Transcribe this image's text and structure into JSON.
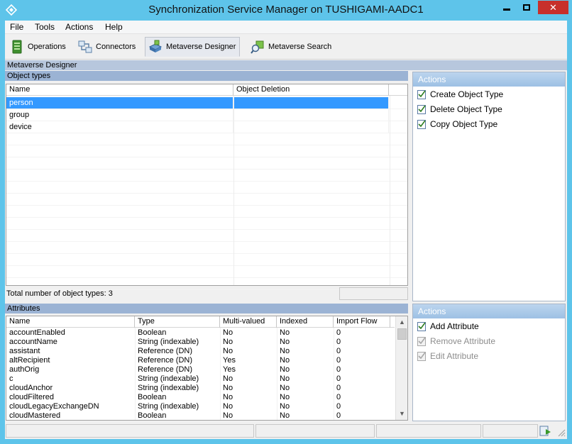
{
  "window": {
    "title": "Synchronization Service Manager on TUSHIGAMI-AADC1",
    "close_glyph": "✕"
  },
  "menu": [
    "File",
    "Tools",
    "Actions",
    "Help"
  ],
  "toolbar": {
    "operations": "Operations",
    "connectors": "Connectors",
    "metaverse_designer": "Metaverse Designer",
    "metaverse_search": "Metaverse Search"
  },
  "page_title": "Metaverse Designer",
  "object_types": {
    "section_label": "Object types",
    "columns": [
      "Name",
      "Object Deletion"
    ],
    "rows": [
      {
        "name": "person",
        "deletion": ""
      },
      {
        "name": "group",
        "deletion": ""
      },
      {
        "name": "device",
        "deletion": ""
      }
    ],
    "selected": "person",
    "total_text": "Total number of object types: 3"
  },
  "attributes": {
    "section_label": "Attributes",
    "columns": [
      "Name",
      "Type",
      "Multi-valued",
      "Indexed",
      "Import Flow"
    ],
    "rows": [
      [
        "accountEnabled",
        "Boolean",
        "No",
        "No",
        "0"
      ],
      [
        "accountName",
        "String (indexable)",
        "No",
        "No",
        "0"
      ],
      [
        "assistant",
        "Reference (DN)",
        "No",
        "No",
        "0"
      ],
      [
        "altRecipient",
        "Reference (DN)",
        "Yes",
        "No",
        "0"
      ],
      [
        "authOrig",
        "Reference (DN)",
        "Yes",
        "No",
        "0"
      ],
      [
        "c",
        "String (indexable)",
        "No",
        "No",
        "0"
      ],
      [
        "cloudAnchor",
        "String (indexable)",
        "No",
        "No",
        "0"
      ],
      [
        "cloudFiltered",
        "Boolean",
        "No",
        "No",
        "0"
      ],
      [
        "cloudLegacyExchangeDN",
        "String (indexable)",
        "No",
        "No",
        "0"
      ],
      [
        "cloudMastered",
        "Boolean",
        "No",
        "No",
        "0"
      ]
    ]
  },
  "actions_top": {
    "title": "Actions",
    "items": [
      "Create Object Type",
      "Delete Object Type",
      "Copy Object Type"
    ]
  },
  "actions_bottom": {
    "title": "Actions",
    "items": [
      {
        "label": "Add Attribute",
        "enabled": true
      },
      {
        "label": "Remove Attribute",
        "enabled": false
      },
      {
        "label": "Edit Attribute",
        "enabled": false
      }
    ]
  },
  "colors": {
    "title_bar": "#5ec4ea",
    "selection": "#3399ff",
    "section_header": "#9bb3d4",
    "close_button": "#c7302b"
  }
}
